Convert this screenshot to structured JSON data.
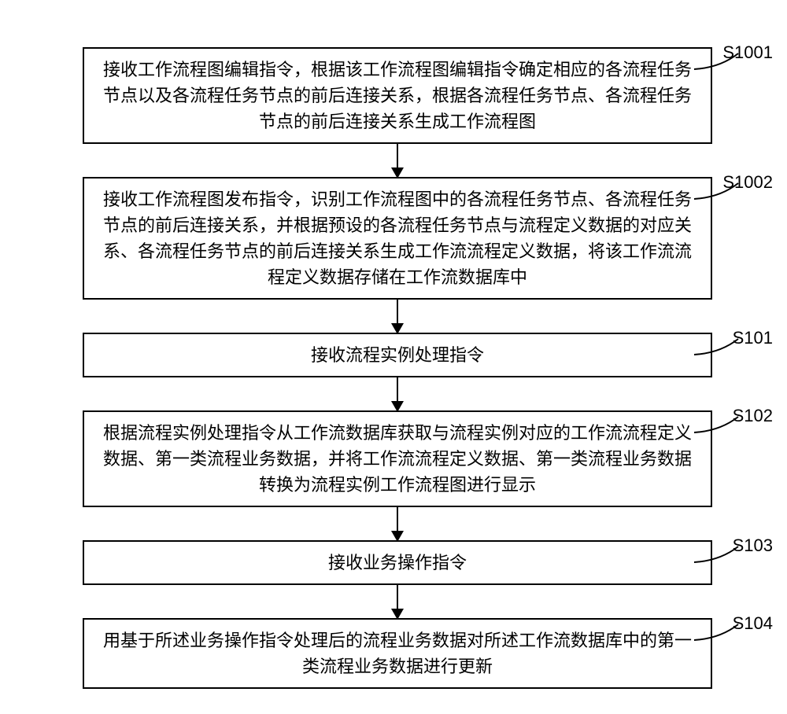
{
  "steps": [
    {
      "label": "S1001",
      "text": "接收工作流程图编辑指令，根据该工作流程图编辑指令确定相应的各流程任务节点以及各流程任务节点的前后连接关系，根据各流程任务节点、各流程任务节点的前后连接关系生成工作流程图",
      "class": "tall-3"
    },
    {
      "label": "S1002",
      "text": "接收工作流程图发布指令，识别工作流程图中的各流程任务节点、各流程任务节点的前后连接关系，并根据预设的各流程任务节点与流程定义数据的对应关系、各流程任务节点的前后连接关系生成工作流流程定义数据，将该工作流流程定义数据存储在工作流数据库中",
      "class": "tall-4"
    },
    {
      "label": "S101",
      "text": "接收流程实例处理指令",
      "class": "single"
    },
    {
      "label": "S102",
      "text": "根据流程实例处理指令从工作流数据库获取与流程实例对应的工作流流程定义数据、第一类流程业务数据，并将工作流流程定义数据、第一类流程业务数据转换为流程实例工作流程图进行显示",
      "class": "tall-3"
    },
    {
      "label": "S103",
      "text": "接收业务操作指令",
      "class": "single"
    },
    {
      "label": "S104",
      "text": "用基于所述业务操作指令处理后的流程业务数据对所述工作流数据库中的第一类流程业务数据进行更新",
      "class": "tall-2"
    }
  ]
}
